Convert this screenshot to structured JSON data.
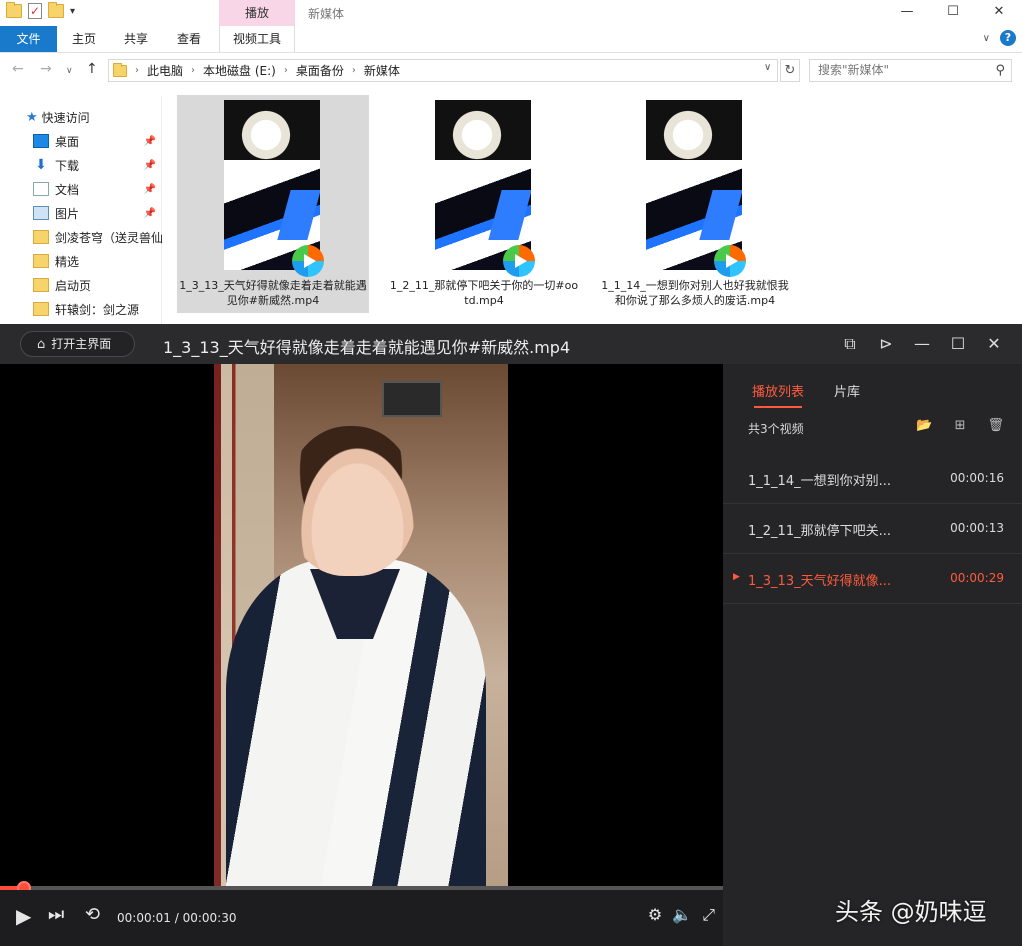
{
  "explorer": {
    "window_title": "新媒体",
    "context_tab": "播放",
    "ribbon_tabs": [
      "文件",
      "主页",
      "共享",
      "查看",
      "视频工具"
    ],
    "address": [
      "此电脑",
      "本地磁盘 (E:)",
      "桌面备份",
      "新媒体"
    ],
    "search_placeholder": "搜索\"新媒体\"",
    "nav": {
      "quick_access": "快速访问",
      "items": [
        {
          "label": "桌面",
          "icon": "desktop-icon",
          "pinned": true
        },
        {
          "label": "下载",
          "icon": "download-icon",
          "pinned": true
        },
        {
          "label": "文档",
          "icon": "document-icon",
          "pinned": true
        },
        {
          "label": "图片",
          "icon": "picture-icon",
          "pinned": true
        },
        {
          "label": "剑凌苍穹（送灵兽仙",
          "icon": "folder-icon",
          "pinned": false
        },
        {
          "label": "精选",
          "icon": "folder-icon",
          "pinned": false
        },
        {
          "label": "启动页",
          "icon": "folder-icon",
          "pinned": false
        },
        {
          "label": "轩辕剑：剑之源",
          "icon": "folder-icon",
          "pinned": false
        }
      ]
    },
    "files": [
      {
        "name": "1_3_13_天气好得就像走着走着就能遇见你#新威然.mp4",
        "selected": true
      },
      {
        "name": "1_2_11_那就停下吧关于你的一切#ootd.mp4",
        "selected": false
      },
      {
        "name": "1_1_14_一想到你对别人也好我就恨我和你说了那么多烦人的废话.mp4",
        "selected": false
      }
    ]
  },
  "player": {
    "home_button": "打开主界面",
    "title": "1_3_13_天气好得就像走着走着就能遇见你#新威然.mp4",
    "progress_fraction": 0.033,
    "current_time": "00:00:01",
    "total_time": "00:00:30",
    "playlist": {
      "tabs": [
        "播放列表",
        "片库"
      ],
      "count_label": "共3个视频",
      "items": [
        {
          "name": "1_1_14_一想到你对别...",
          "duration": "00:00:16",
          "current": false
        },
        {
          "name": "1_2_11_那就停下吧关...",
          "duration": "00:00:13",
          "current": false
        },
        {
          "name": "1_3_13_天气好得就像...",
          "duration": "00:00:29",
          "current": true
        }
      ]
    },
    "accent_color": "#ff5a3c"
  },
  "watermark": "头条 @奶味逗"
}
